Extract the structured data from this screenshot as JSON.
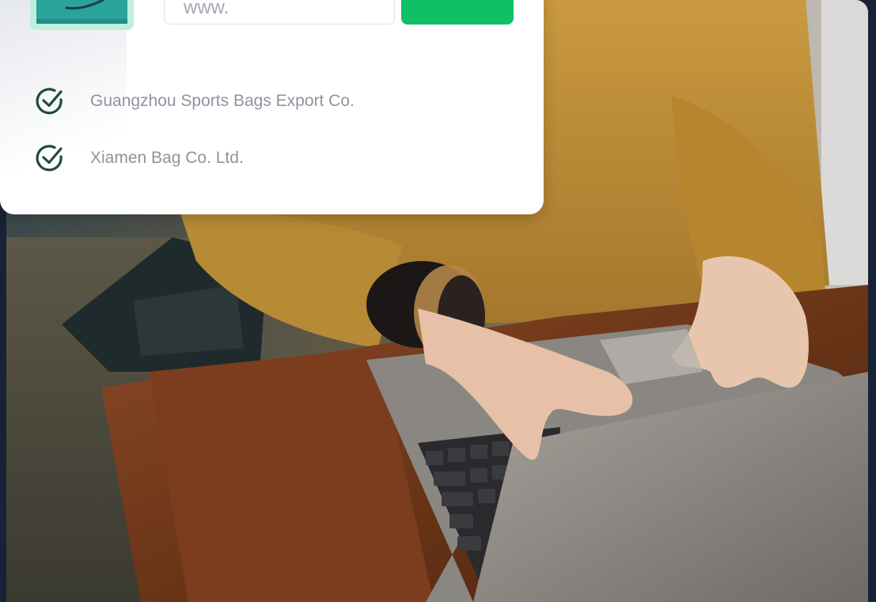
{
  "search": {
    "placeholder": "www.",
    "submit_label": ""
  },
  "product": {
    "icon": "sports-bag-thumbnail"
  },
  "suppliers": [
    {
      "name": "Guangzhou Sports Bags Export Co.",
      "icon": "check-circle-icon"
    },
    {
      "name": "Xiamen Bag Co. Ltd.",
      "icon": "check-circle-icon"
    }
  ],
  "colors": {
    "accent": "#10c064",
    "check": "#1f4a3d",
    "supplier_text": "#8e93a0",
    "page_background": "#182236",
    "thumbnail_bg": "#bfeedd"
  },
  "background_photo": {
    "icon": "woman-typing-on-laptop-photo"
  }
}
